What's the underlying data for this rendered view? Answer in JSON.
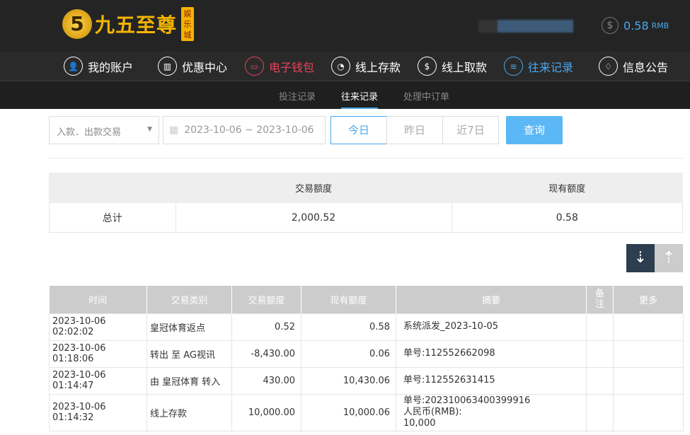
{
  "header": {
    "logo_digit": "5",
    "logo_text": "九五至尊",
    "logo_badge": "娱乐城",
    "balance": "0.58",
    "currency": "RMB"
  },
  "nav": [
    {
      "label": "我的账户",
      "icon": "user-icon"
    },
    {
      "label": "优惠中心",
      "icon": "gift-icon"
    },
    {
      "label": "电子钱包",
      "icon": "wallet-icon"
    },
    {
      "label": "线上存款",
      "icon": "deposit-icon"
    },
    {
      "label": "线上取款",
      "icon": "withdraw-icon"
    },
    {
      "label": "往来记录",
      "icon": "records-icon"
    },
    {
      "label": "信息公告",
      "icon": "bell-icon"
    }
  ],
  "subnav": [
    "投注记录",
    "往来记录",
    "处理中订单"
  ],
  "filters": {
    "type": "入款．出款交易",
    "date_range": "2023-10-06 ~ 2023-10-06",
    "today": "今日",
    "yesterday": "昨日",
    "last7": "近7日",
    "search": "查询"
  },
  "summary": {
    "headers": [
      "",
      "交易额度",
      "现有额度"
    ],
    "label": "总计",
    "amount": "2,000.52",
    "balance": "0.58"
  },
  "table": {
    "headers": [
      "时间",
      "交易类别",
      "交易额度",
      "现有额度",
      "摘要",
      "备注",
      "更多"
    ],
    "rows": [
      {
        "time": "2023-10-06 02:02:02",
        "type": "皇冠体育返点",
        "amount": "0.52",
        "balance": "0.58",
        "memo": [
          "系统派发_2023-10-05"
        ]
      },
      {
        "time": "2023-10-06 01:18:06",
        "type": "转出 至 AG视讯",
        "amount": "-8,430.00",
        "balance": "0.06",
        "memo": [
          "单号:112552662098"
        ]
      },
      {
        "time": "2023-10-06 01:14:47",
        "type": "由 皇冠体育 转入",
        "amount": "430.00",
        "balance": "10,430.06",
        "memo": [
          "单号:112552631415"
        ]
      },
      {
        "time": "2023-10-06 01:14:32",
        "type": "线上存款",
        "amount": "10,000.00",
        "balance": "10,000.06",
        "memo": [
          "单号:202310063400399916",
          "人民币(RMB):",
          "10,000"
        ]
      }
    ]
  }
}
